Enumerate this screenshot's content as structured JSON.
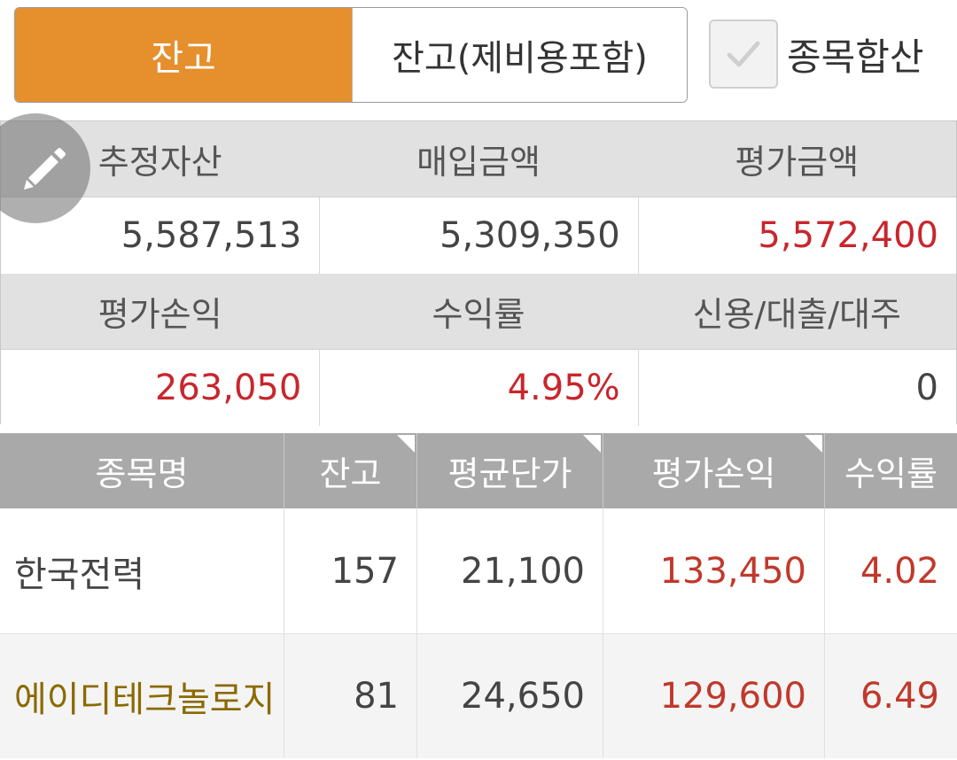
{
  "tabs": {
    "balance": "잔고",
    "balance_with_fees": "잔고(제비용포함)"
  },
  "sum_by_stock": {
    "label": "종목합산",
    "checked": true
  },
  "summary": {
    "headers_row1": [
      "추정자산",
      "매입금액",
      "평가금액"
    ],
    "values_row1": [
      "5,587,513",
      "5,309,350",
      "5,572,400"
    ],
    "headers_row2": [
      "평가손익",
      "수익률",
      "신용/대출/대주"
    ],
    "values_row2": [
      "263,050",
      "4.95%",
      "0"
    ]
  },
  "holdings": {
    "columns": [
      "종목명",
      "잔고",
      "평균단가",
      "평가손익",
      "수익률"
    ],
    "rows": [
      {
        "name": "한국전력",
        "qty": "157",
        "avg_price": "21,100",
        "pnl": "133,450",
        "rate": "4.02"
      },
      {
        "name": "에이디테크놀로지",
        "qty": "81",
        "avg_price": "24,650",
        "pnl": "129,600",
        "rate": "6.49"
      }
    ]
  },
  "colors": {
    "accent": "#e58f2d",
    "profit_red": "#c8262d",
    "header_gray": "#a9a9a9",
    "stock_name_gold": "#8a6a00"
  },
  "icons": {
    "edit": "pencil-icon",
    "check": "checkmark-icon"
  }
}
